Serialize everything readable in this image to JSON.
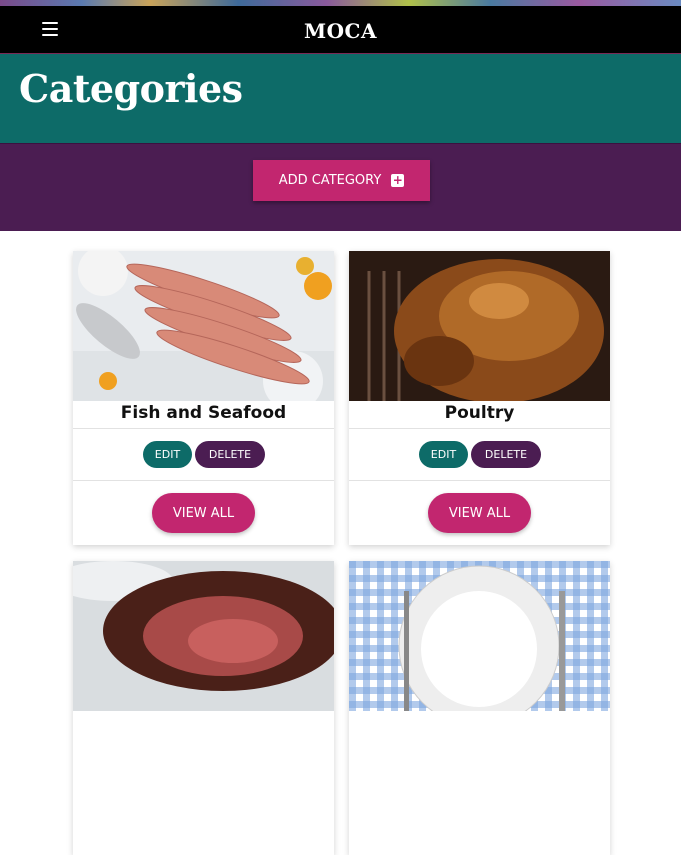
{
  "header": {
    "brand": "MOCA",
    "menu_icon": "hamburger-icon"
  },
  "page": {
    "title": "Categories"
  },
  "toolbar": {
    "add_label": "ADD CATEGORY",
    "add_icon": "plus-square-icon"
  },
  "categories": [
    {
      "name": "Fish and Seafood",
      "edit": "EDIT",
      "delete": "DELETE",
      "view_all": "VIEW ALL"
    },
    {
      "name": "Poultry",
      "edit": "EDIT",
      "delete": "DELETE",
      "view_all": "VIEW ALL"
    },
    {
      "name": "",
      "edit": "",
      "delete": "",
      "view_all": ""
    },
    {
      "name": "",
      "edit": "",
      "delete": "",
      "view_all": ""
    }
  ],
  "colors": {
    "teal": "#0d6b68",
    "purple": "#4b1d52",
    "pink": "#c2266f",
    "black": "#000000"
  }
}
